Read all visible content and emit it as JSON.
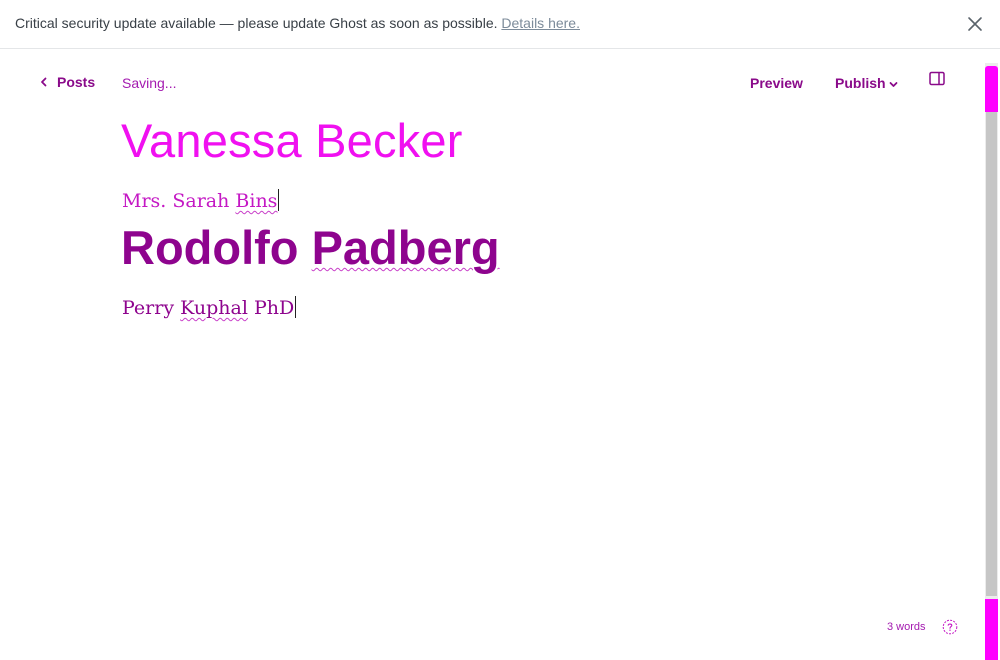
{
  "banner": {
    "message": "Critical security update available — please update Ghost as soon as possible.",
    "link_text": "Details here."
  },
  "toolbar": {
    "back_label": "Posts",
    "status": "Saving...",
    "preview_label": "Preview",
    "publish_label": "Publish"
  },
  "editor": {
    "title": "Vanessa Becker",
    "paragraph1_pre": "Mrs. Sarah ",
    "paragraph1_misspelled": "Bins",
    "heading_pre": "Rodolfo ",
    "heading_misspelled": "Padberg",
    "paragraph2_pre": "Perry ",
    "paragraph2_misspelled": "Kuphal",
    "paragraph2_post": " PhD"
  },
  "footer": {
    "word_count": "3 words"
  },
  "colors": {
    "accent": "#8a0a8a",
    "title": "#f010f0",
    "scrollbar_highlight": "#ff00ff"
  },
  "icons": {
    "back": "chevron-left-icon",
    "publish": "chevron-down-icon",
    "sidebar": "sidebar-toggle-icon",
    "close": "close-icon",
    "help": "help-icon"
  }
}
